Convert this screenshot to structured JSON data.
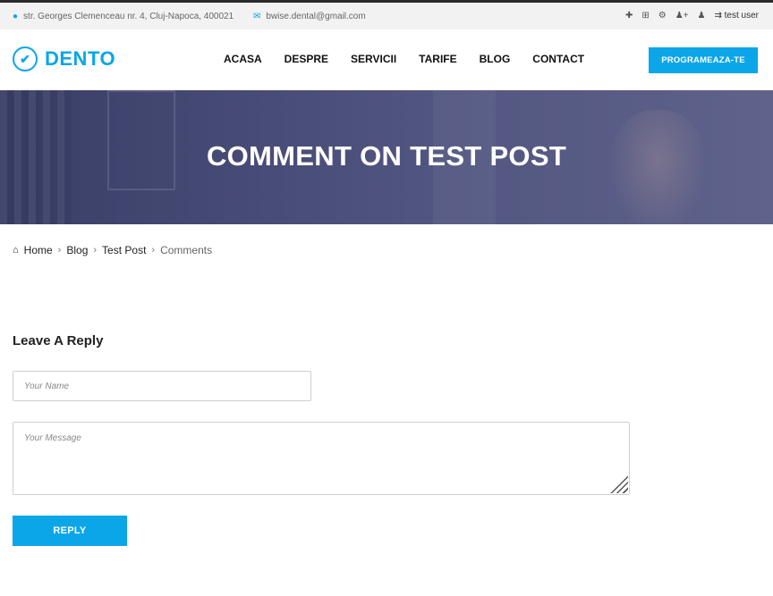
{
  "topbar": {
    "address": "str. Georges Clemenceau nr. 4, Cluj-Napoca, 400021",
    "email": "bwise.dental@gmail.com",
    "user_label": "test user"
  },
  "header": {
    "brand": "DENTO",
    "nav": [
      "ACASA",
      "DESPRE",
      "SERVICII",
      "TARIFE",
      "BLOG",
      "CONTACT"
    ],
    "cta_label": "PROGRAMEAZA-TE"
  },
  "hero": {
    "title": "COMMENT ON TEST POST"
  },
  "breadcrumb": {
    "items": [
      "Home",
      "Blog",
      "Test Post",
      "Comments"
    ]
  },
  "form": {
    "title": "Leave A Reply",
    "name_placeholder": "Your Name",
    "message_placeholder": "Your Message",
    "submit_label": "REPLY"
  },
  "colors": {
    "accent": "#0aa6e8",
    "hero_overlay": "#2f3466"
  }
}
